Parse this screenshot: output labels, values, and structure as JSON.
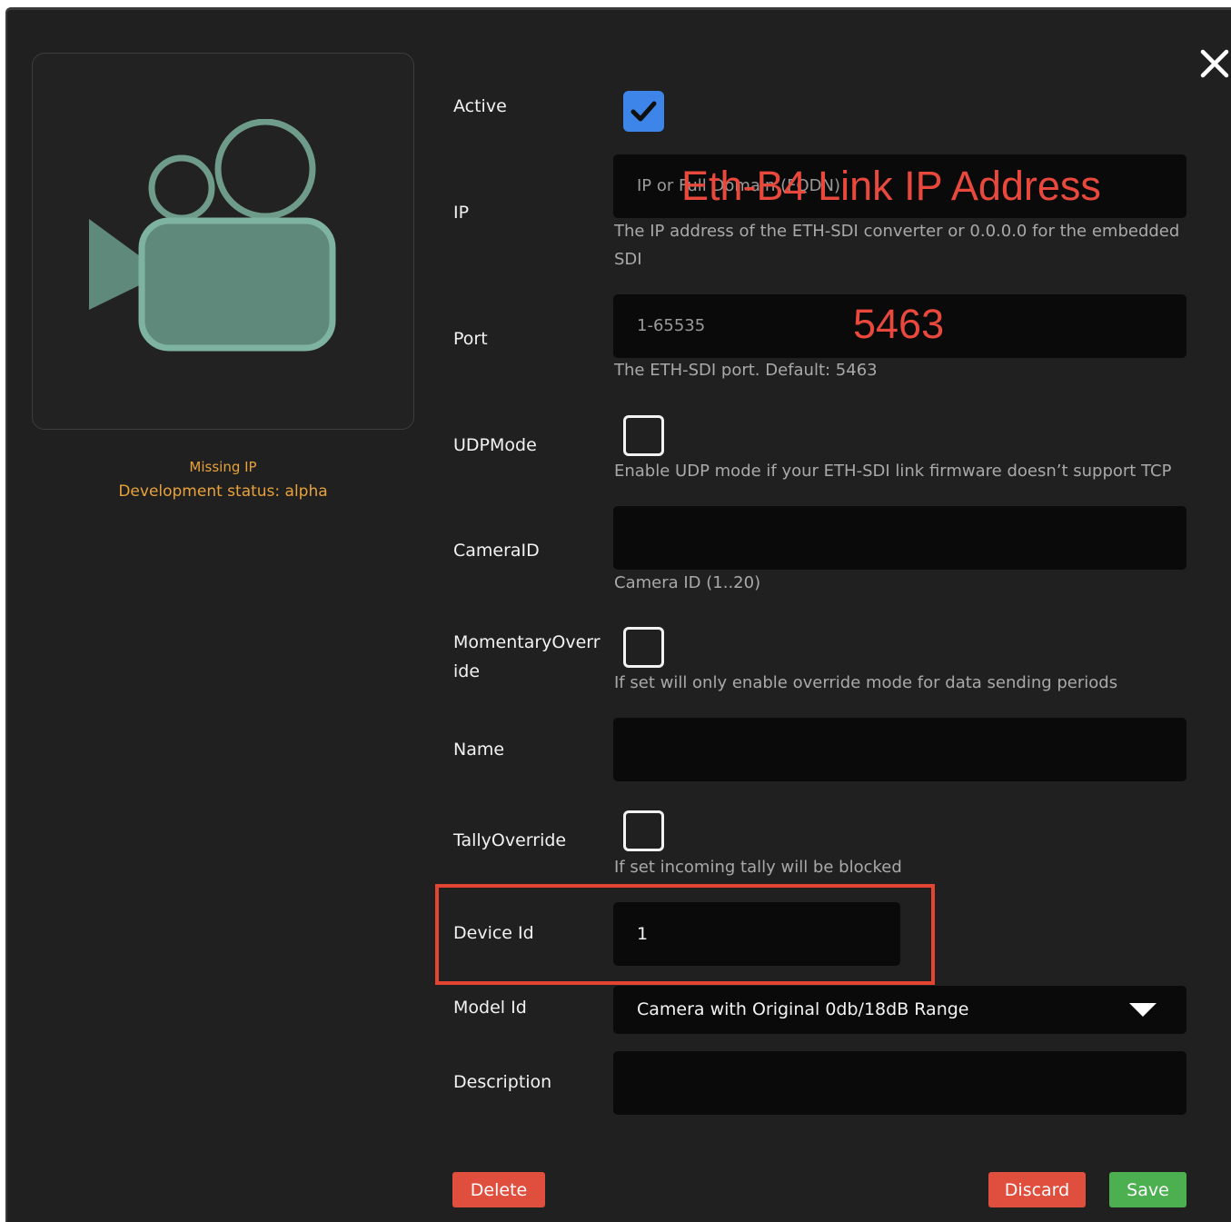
{
  "dialog": {
    "close_icon": "close-icon"
  },
  "device": {
    "icon": "video-camera-icon",
    "icon_color": "#6f9b8b",
    "status_missing": "Missing IP",
    "status_dev": "Development status: alpha"
  },
  "fields": {
    "active": {
      "label": "Active",
      "checked": true
    },
    "ip": {
      "label": "IP",
      "placeholder": "IP or Full Domain (FQDN)",
      "value": "",
      "help": "The IP address of the ETH-SDI converter or 0.0.0.0 for the embedded SDI"
    },
    "port": {
      "label": "Port",
      "placeholder": "1-65535",
      "value": "",
      "help": "The ETH-SDI port. Default: 5463"
    },
    "udpmode": {
      "label": "UDPMode",
      "checked": false,
      "help": "Enable UDP mode if your ETH-SDI link firmware doesn’t support TCP"
    },
    "cameraid": {
      "label": "CameraID",
      "value": "",
      "help": "Camera ID (1..20)"
    },
    "momentary": {
      "label": "MomentaryOverride",
      "checked": false,
      "help": "If set will only enable override mode for data sending periods"
    },
    "name": {
      "label": "Name",
      "value": ""
    },
    "tally": {
      "label": "TallyOverride",
      "checked": false,
      "help": "If set incoming tally will be blocked"
    },
    "device_id": {
      "label": "Device Id",
      "value": "1"
    },
    "model_id": {
      "label": "Model Id",
      "value": "Camera with Original 0db/18dB Range"
    },
    "description": {
      "label": "Description",
      "value": ""
    }
  },
  "annotations": {
    "ip_note": "Eth-B4 Link IP Address",
    "port_note": "5463",
    "color": "#e9493c"
  },
  "buttons": {
    "delete": "Delete",
    "discard": "Discard",
    "save": "Save"
  },
  "colors": {
    "background": "#202020",
    "input_bg": "#0a0a0a",
    "checkbox_checked": "#3d85e8",
    "danger": "#e04e3e",
    "success": "#4caf50",
    "status": "#e9a23b"
  }
}
